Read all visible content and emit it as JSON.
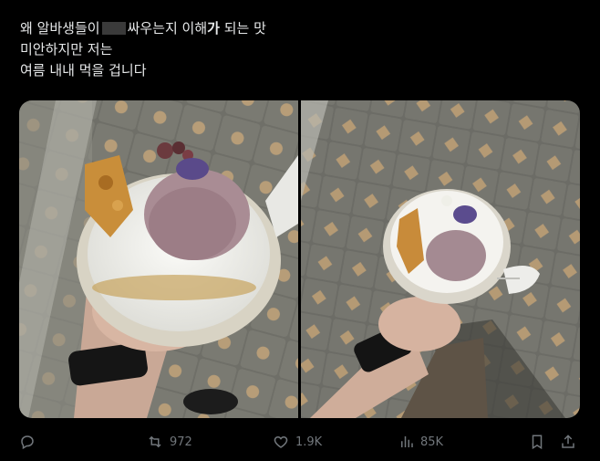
{
  "post": {
    "line1_a": "왜 알바생들이",
    "line1_b": "싸우는지 이해",
    "line1_bold": "가",
    "line1_c": "되는 맛",
    "line2": "미안하지만 저는",
    "line3": "여름 내내 먹을 겁니다"
  },
  "media": {
    "images": [
      {
        "description": "hand holding ice cream cup close-up"
      },
      {
        "description": "hand holding ice cream cup over sidewalk"
      }
    ]
  },
  "actions": {
    "reply_icon": "reply-icon",
    "repost_count": "972",
    "like_count": "1.9K",
    "views_count": "85K"
  },
  "colors": {
    "background": "#000000",
    "text": "#e7e9ea",
    "muted": "#71767b"
  }
}
